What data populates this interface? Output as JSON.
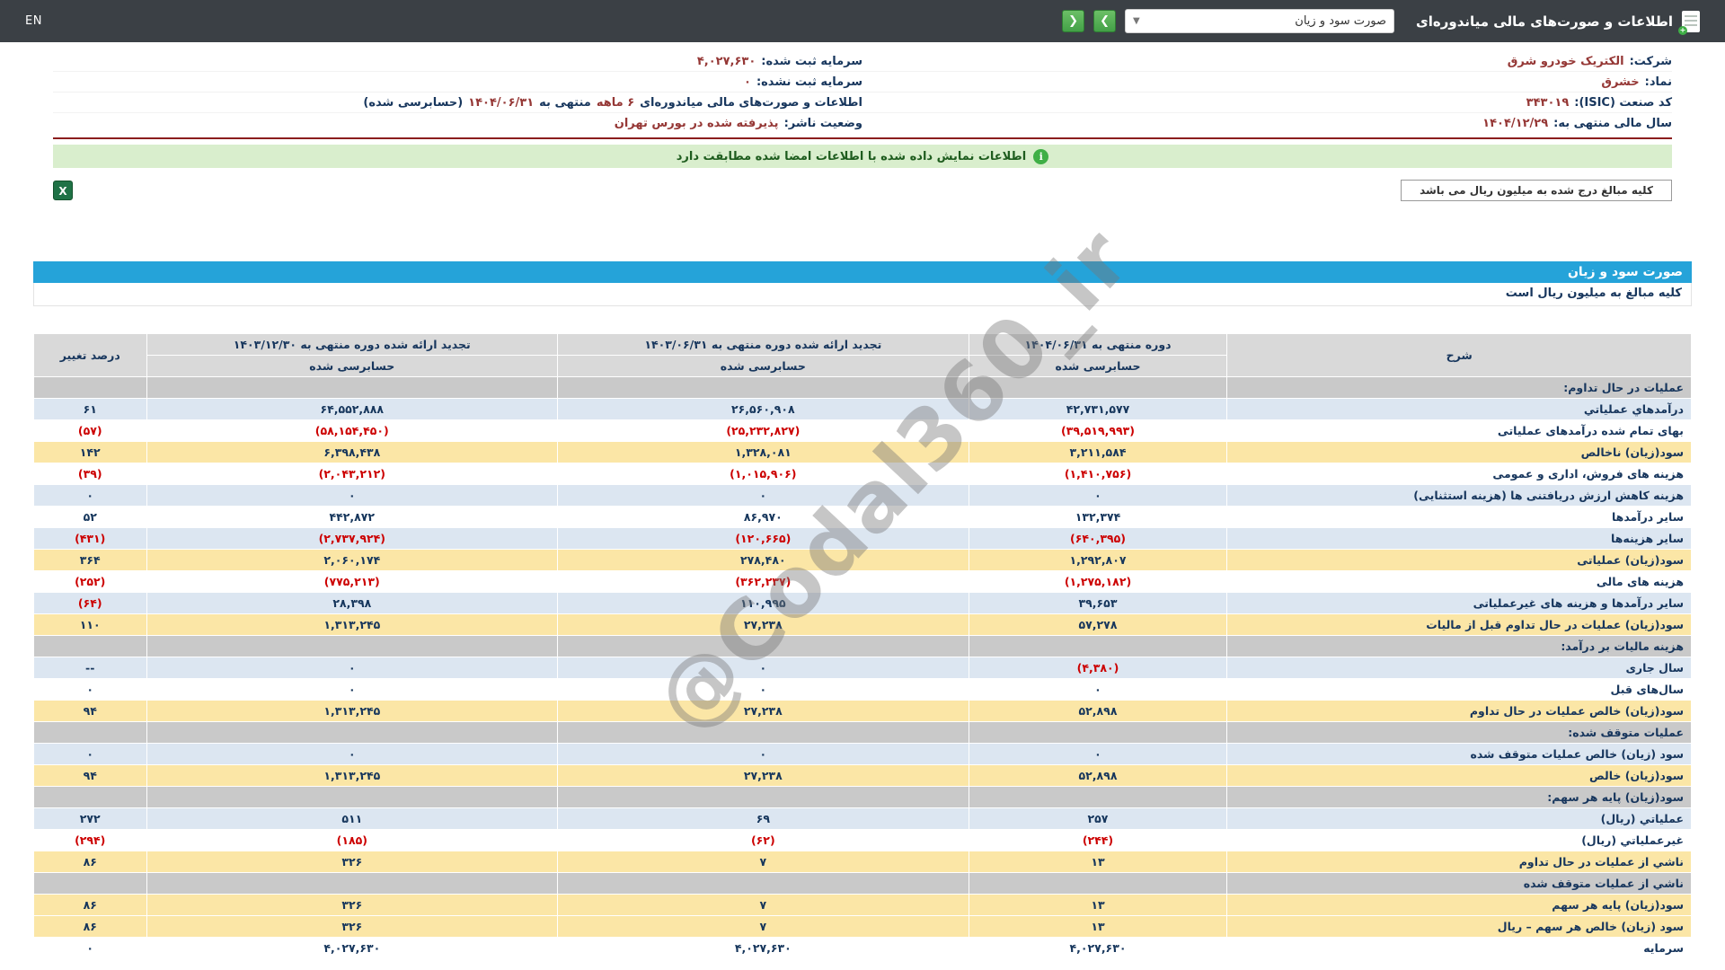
{
  "topbar": {
    "en": "EN",
    "title": "اطلاعات و صورت‌های مالی میاندوره‌ای",
    "report_select_value": "صورت سود و زیان",
    "caret": "▼",
    "next_arrow": "❯",
    "prev_arrow": "❮"
  },
  "icons": {
    "info": "i",
    "excel": "X",
    "doc_badge": "+"
  },
  "company": {
    "rows": [
      {
        "l1": "شرکت:",
        "v1": "الکتریک خودرو شرق",
        "l2": "سرمایه ثبت شده:",
        "v2": "۴,۰۲۷,۶۳۰"
      },
      {
        "l1": "نماد:",
        "v1": "خشرق",
        "l2": "سرمایه ثبت نشده:",
        "v2": "۰"
      },
      {
        "l1": "کد صنعت (ISIC):",
        "v1": "۳۴۳۰۱۹",
        "l2": "اطلاعات و صورت‌های مالی میاندوره‌ای",
        "v2": "۶ ماهه",
        "l3": "منتهی به",
        "v3": "۱۴۰۴/۰۶/۳۱",
        "l4": "(حسابرسی شده)"
      },
      {
        "l1": "سال مالی منتهی به:",
        "v1": "۱۴۰۴/۱۲/۲۹",
        "l2": "وضعیت ناشر:",
        "v2": "پذیرفته شده در بورس تهران"
      }
    ]
  },
  "banner": {
    "text": "اطلاعات نمایش داده شده با اطلاعات امضا شده مطابقت دارد"
  },
  "note": {
    "text": "کلیه مبالغ درج شده به میلیون ریال می باشد"
  },
  "statement": {
    "title": "صورت سود و زیان",
    "subtitle": "کلیه مبالغ به میلیون ریال است"
  },
  "watermark": "@Codal360_ir",
  "colors": {
    "topbar": "#3b4045",
    "accent_blue": "#25a3d9",
    "row_blue": "#dce6f1",
    "row_yellow": "#fbe6a6",
    "section_gray": "#c9c9c9",
    "banner_green": "#d9eecd",
    "negative_red": "#cc0000",
    "value_navy": "#16365c",
    "label_maroon": "#953735",
    "button_green": "#43a047"
  },
  "table": {
    "headers": {
      "desc": "شرح",
      "col1": "دوره منتهی به ۱۴۰۴/۰۶/۳۱",
      "col2": "تجدید ارائه شده دوره منتهی به ۱۴۰۳/۰۶/۳۱",
      "col3": "تجدید ارائه شده دوره منتهی به ۱۴۰۳/۱۲/۳۰",
      "change": "درصد تغییر",
      "audited": "حسابرسی شده"
    },
    "rows": [
      {
        "type": "section",
        "label": "عملیات در حال تداوم:"
      },
      {
        "type": "blue",
        "label": "درآمدهاي عملياتي",
        "v1": "۴۲,۷۳۱,۵۷۷",
        "v2": "۲۶,۵۶۰,۹۰۸",
        "v3": "۶۴,۵۵۲,۸۸۸",
        "chg": "۶۱"
      },
      {
        "type": "white",
        "label": "بهای تمام شده درآمدهای عملیاتی",
        "v1": "(۳۹,۵۱۹,۹۹۳)",
        "v2": "(۲۵,۲۳۲,۸۲۷)",
        "v3": "(۵۸,۱۵۴,۴۵۰)",
        "chg": "(۵۷)"
      },
      {
        "type": "yellow",
        "label": "سود(زیان) ناخالص",
        "v1": "۳,۲۱۱,۵۸۴",
        "v2": "۱,۳۲۸,۰۸۱",
        "v3": "۶,۳۹۸,۴۳۸",
        "chg": "۱۴۲"
      },
      {
        "type": "white",
        "label": "هزینه های فروش، اداری و عمومی",
        "v1": "(۱,۴۱۰,۷۵۶)",
        "v2": "(۱,۰۱۵,۹۰۶)",
        "v3": "(۲,۰۴۳,۲۱۲)",
        "chg": "(۳۹)"
      },
      {
        "type": "blue",
        "label": "هزینه کاهش ارزش دریافتنی ها (هزینه استثنایی)",
        "v1": "۰",
        "v2": "۰",
        "v3": "۰",
        "chg": "۰"
      },
      {
        "type": "white",
        "label": "سایر درآمدها",
        "v1": "۱۳۲,۳۷۴",
        "v2": "۸۶,۹۷۰",
        "v3": "۴۴۲,۸۷۲",
        "chg": "۵۲"
      },
      {
        "type": "blue",
        "label": "سایر هزینه‌ها",
        "v1": "(۶۴۰,۳۹۵)",
        "v2": "(۱۲۰,۶۶۵)",
        "v3": "(۲,۷۳۷,۹۲۴)",
        "chg": "(۴۳۱)"
      },
      {
        "type": "yellow",
        "label": "سود(زیان) عملیاتی",
        "v1": "۱,۲۹۲,۸۰۷",
        "v2": "۲۷۸,۴۸۰",
        "v3": "۲,۰۶۰,۱۷۴",
        "chg": "۳۶۴"
      },
      {
        "type": "white",
        "label": "هزینه های مالی",
        "v1": "(۱,۲۷۵,۱۸۲)",
        "v2": "(۳۶۲,۲۳۷)",
        "v3": "(۷۷۵,۲۱۳)",
        "chg": "(۲۵۲)"
      },
      {
        "type": "blue",
        "label": "سایر درآمدها و هزینه های غیرعملیاتی",
        "v1": "۳۹,۶۵۳",
        "v2": "۱۱۰,۹۹۵",
        "v3": "۲۸,۳۹۸",
        "chg": "(۶۴)"
      },
      {
        "type": "yellow",
        "label": "سود(زیان) عملیات در حال تداوم قبل از مالیات",
        "v1": "۵۷,۲۷۸",
        "v2": "۲۷,۲۳۸",
        "v3": "۱,۳۱۳,۲۴۵",
        "chg": "۱۱۰"
      },
      {
        "type": "section",
        "label": "هزینه مالیات بر درآمد:"
      },
      {
        "type": "blue",
        "label": "سال جاری",
        "v1": "(۴,۳۸۰)",
        "v2": "۰",
        "v3": "۰",
        "chg": "--"
      },
      {
        "type": "white",
        "label": "سال‌های قبل",
        "v1": "۰",
        "v2": "۰",
        "v3": "۰",
        "chg": "۰"
      },
      {
        "type": "yellow",
        "label": "سود(زیان) خالص عملیات در حال تداوم",
        "v1": "۵۲,۸۹۸",
        "v2": "۲۷,۲۳۸",
        "v3": "۱,۳۱۳,۲۴۵",
        "chg": "۹۴"
      },
      {
        "type": "section",
        "label": "عملیات متوقف شده:"
      },
      {
        "type": "blue",
        "label": "سود (زیان) خالص عملیات متوقف شده",
        "v1": "۰",
        "v2": "۰",
        "v3": "۰",
        "chg": "۰"
      },
      {
        "type": "yellow",
        "label": "سود(زیان) خالص",
        "v1": "۵۲,۸۹۸",
        "v2": "۲۷,۲۳۸",
        "v3": "۱,۳۱۳,۲۴۵",
        "chg": "۹۴"
      },
      {
        "type": "section",
        "label": "سود(زیان) پایه هر سهم:"
      },
      {
        "type": "blue",
        "label": "عملیاتي (ریال)",
        "v1": "۲۵۷",
        "v2": "۶۹",
        "v3": "۵۱۱",
        "chg": "۲۷۲"
      },
      {
        "type": "white",
        "label": "غیرعملیاتي (ریال)",
        "v1": "(۲۴۴)",
        "v2": "(۶۲)",
        "v3": "(۱۸۵)",
        "chg": "(۲۹۴)"
      },
      {
        "type": "yellow",
        "label": "ناشي از عملیات در حال تداوم",
        "v1": "۱۳",
        "v2": "۷",
        "v3": "۳۲۶",
        "chg": "۸۶"
      },
      {
        "type": "muted",
        "label": "ناشي از عملیات متوقف شده"
      },
      {
        "type": "yellow",
        "label": "سود(زیان) پایه هر سهم",
        "v1": "۱۳",
        "v2": "۷",
        "v3": "۳۲۶",
        "chg": "۸۶"
      },
      {
        "type": "yellow",
        "label": "سود (زیان) خالص هر سهم – ریال",
        "v1": "۱۳",
        "v2": "۷",
        "v3": "۳۲۶",
        "chg": "۸۶"
      },
      {
        "type": "white",
        "label": "سرمایه",
        "v1": "۴,۰۲۷,۶۳۰",
        "v2": "۴,۰۲۷,۶۳۰",
        "v3": "۴,۰۲۷,۶۳۰",
        "chg": "۰"
      }
    ]
  }
}
